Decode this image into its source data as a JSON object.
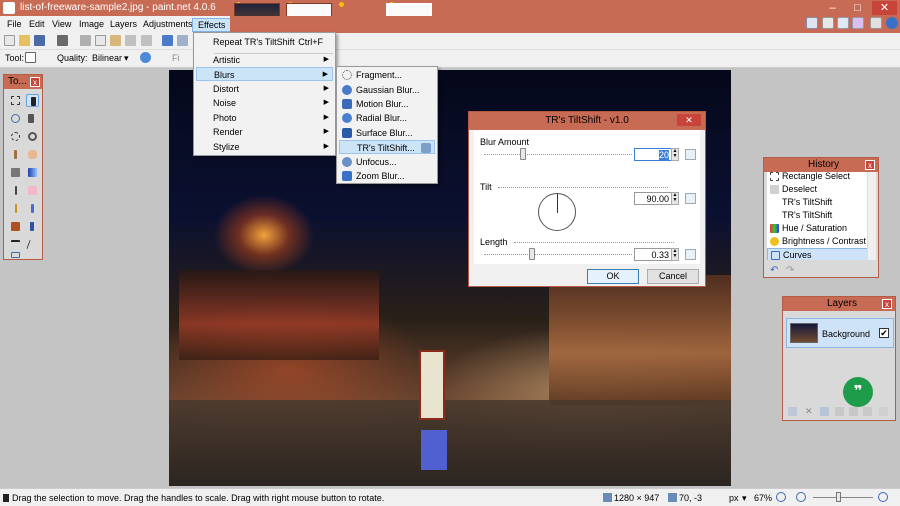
{
  "window": {
    "title": "list-of-freeware-sample2.jpg - paint.net 4.0.6",
    "minimize_glyph": "–",
    "maximize_glyph": "□",
    "close_glyph": "✕"
  },
  "menu": {
    "file": "File",
    "edit": "Edit",
    "view": "View",
    "image": "Image",
    "layers": "Layers",
    "adjustments": "Adjustments",
    "effects": "Effects"
  },
  "toolbar": {
    "tool_label": "Tool:",
    "quality_label": "Quality:",
    "quality_value": "Bilinear",
    "finish_label": "Fi"
  },
  "effects_menu": {
    "repeat": "Repeat TR's TiltShift",
    "repeat_shortcut": "Ctrl+F",
    "items": [
      "Artistic",
      "Blurs",
      "Distort",
      "Noise",
      "Photo",
      "Render",
      "Stylize"
    ]
  },
  "blurs_menu": {
    "items": [
      "Fragment...",
      "Gaussian Blur...",
      "Motion Blur...",
      "Radial Blur...",
      "Surface Blur...",
      "TR's TiltShift...",
      "Unfocus...",
      "Zoom Blur..."
    ]
  },
  "tools_panel": {
    "title": "To..."
  },
  "dialog": {
    "title": "TR's TiltShift - v1.0",
    "blur_amount_label": "Blur Amount",
    "blur_amount_value": "20",
    "tilt_label": "Tilt",
    "tilt_value": "90.00",
    "length_label": "Length",
    "length_value": "0.33",
    "ok_label": "OK",
    "cancel_label": "Cancel",
    "close_glyph": "✕"
  },
  "history": {
    "title": "History",
    "items": [
      "Rectangle Select",
      "Deselect",
      "TR's TiltShift",
      "TR's TiltShift",
      "Hue / Saturation",
      "Brightness / Contrast",
      "Curves"
    ]
  },
  "layers": {
    "title": "Layers",
    "layer_name": "Background",
    "visible_check": "✔"
  },
  "status": {
    "hint": "Drag the selection to move. Drag the handles to scale. Drag with right mouse button to rotate.",
    "image_size": "1280 × 947",
    "cursor_pos": "70, -3",
    "unit": "px",
    "zoom": "67%"
  },
  "colors": {
    "accent": "#c86b55",
    "highlight": "#cce4f7",
    "selection": "#3b7ed6",
    "fab": "#1e9c4a"
  }
}
